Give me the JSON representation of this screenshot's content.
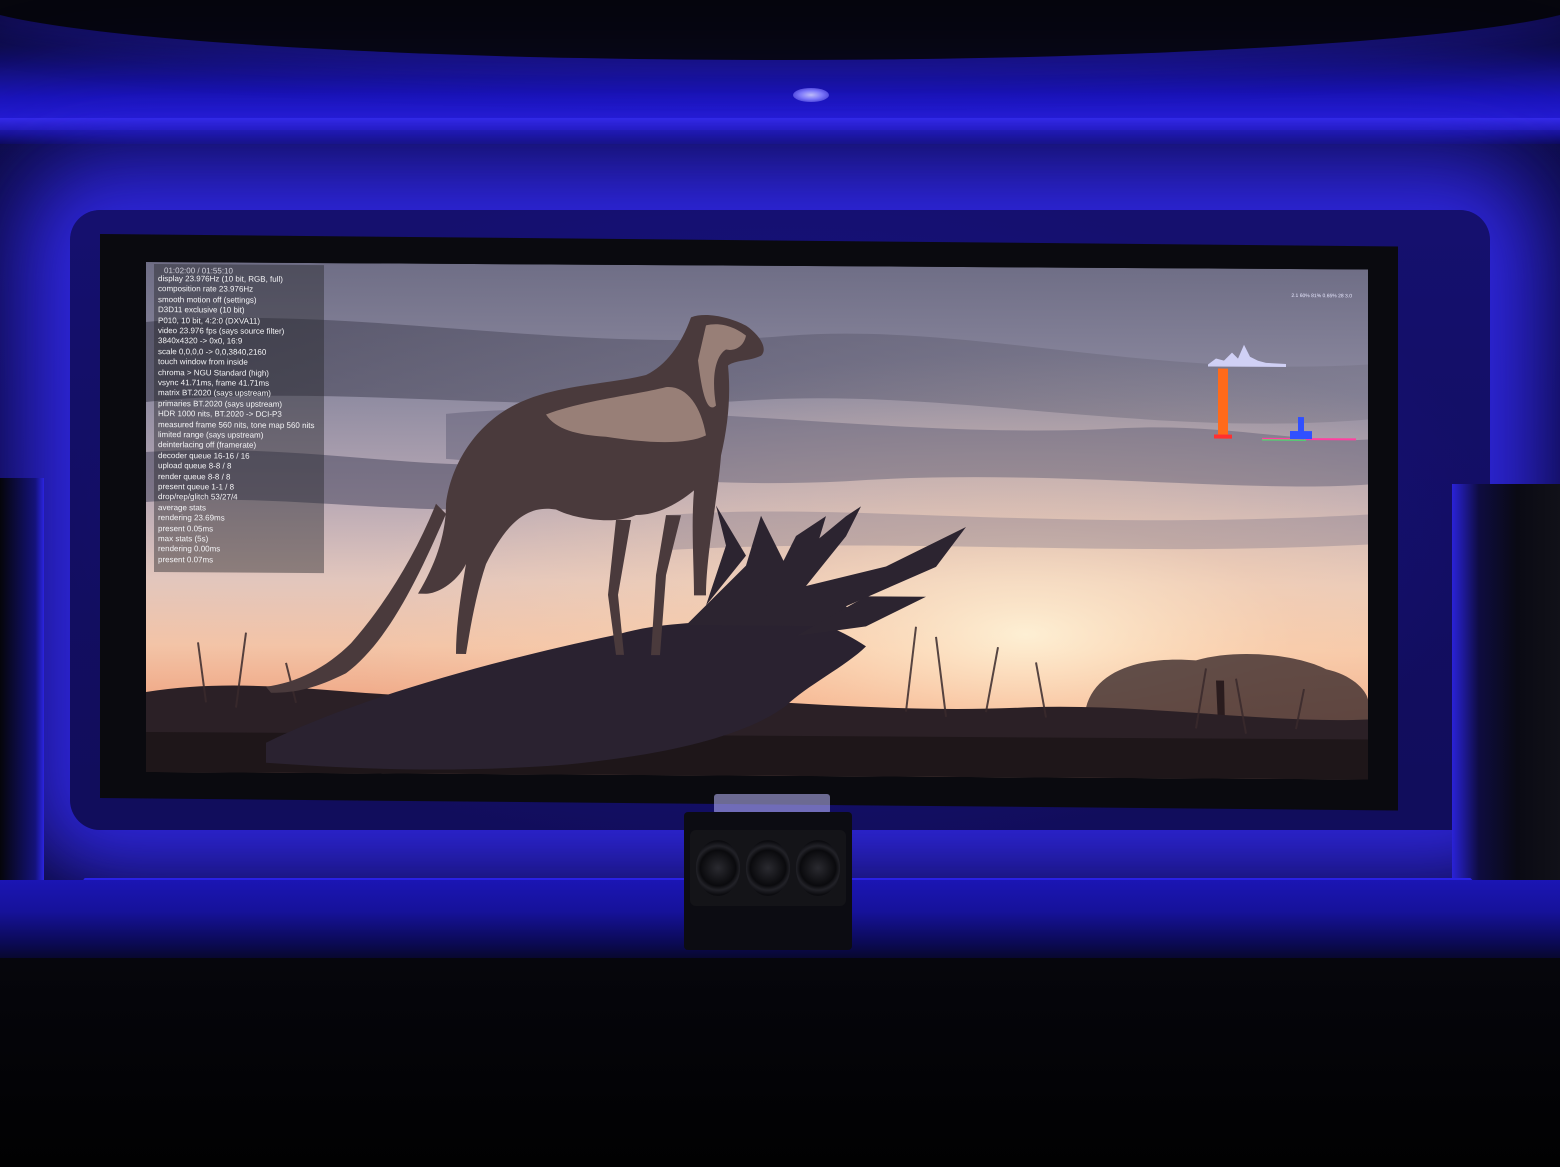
{
  "scene": {
    "description_tag": "home-theater",
    "backlight_color": "#3a30f0",
    "wall_color": "#0a0a28"
  },
  "osd": {
    "title": "01:02:00 / 01:55:10",
    "lines": [
      "display 23.976Hz (10 bit, RGB, full)",
      "composition rate 23.976Hz",
      "smooth motion off (settings)",
      "D3D11 exclusive (10 bit)",
      "P010, 10 bit, 4:2:0 (DXVA11)",
      "video 23.976 fps  (says source filter)",
      "3840x4320 -> 0x0, 16:9",
      "scale 0,0,0,0 -> 0,0,3840,2160",
      "touch window from inside",
      "chroma > NGU Standard (high)",
      "vsync 41.71ms, frame 41.71ms",
      "matrix BT.2020 (says upstream)",
      "primaries BT.2020 (says upstream)",
      "HDR 1000 nits, BT.2020 -> DCI-P3",
      "measured frame 560 nits, tone map 560 nits",
      "limited range (says upstream)",
      "deinterlacing off (framerate)",
      "decoder queue 16-16 / 16",
      "upload queue 8-8 / 8",
      "render queue 8-8 / 8",
      "present queue 1-1 / 8",
      "drop/rep/glitch 53/27/4",
      "average stats",
      "  rendering 23.69ms",
      "  present 0.05ms",
      "max stats (5s)",
      "  rendering 0.00ms",
      "  present 0.07ms"
    ],
    "topright": "2.1 60% 81% 0.65% 28 3.0"
  },
  "histograms": {
    "luma_color": "#d8d8ff",
    "bar_color": "#ff6a1a",
    "rgb_colors": [
      "#ff3030",
      "#30ff60",
      "#3050ff"
    ]
  }
}
